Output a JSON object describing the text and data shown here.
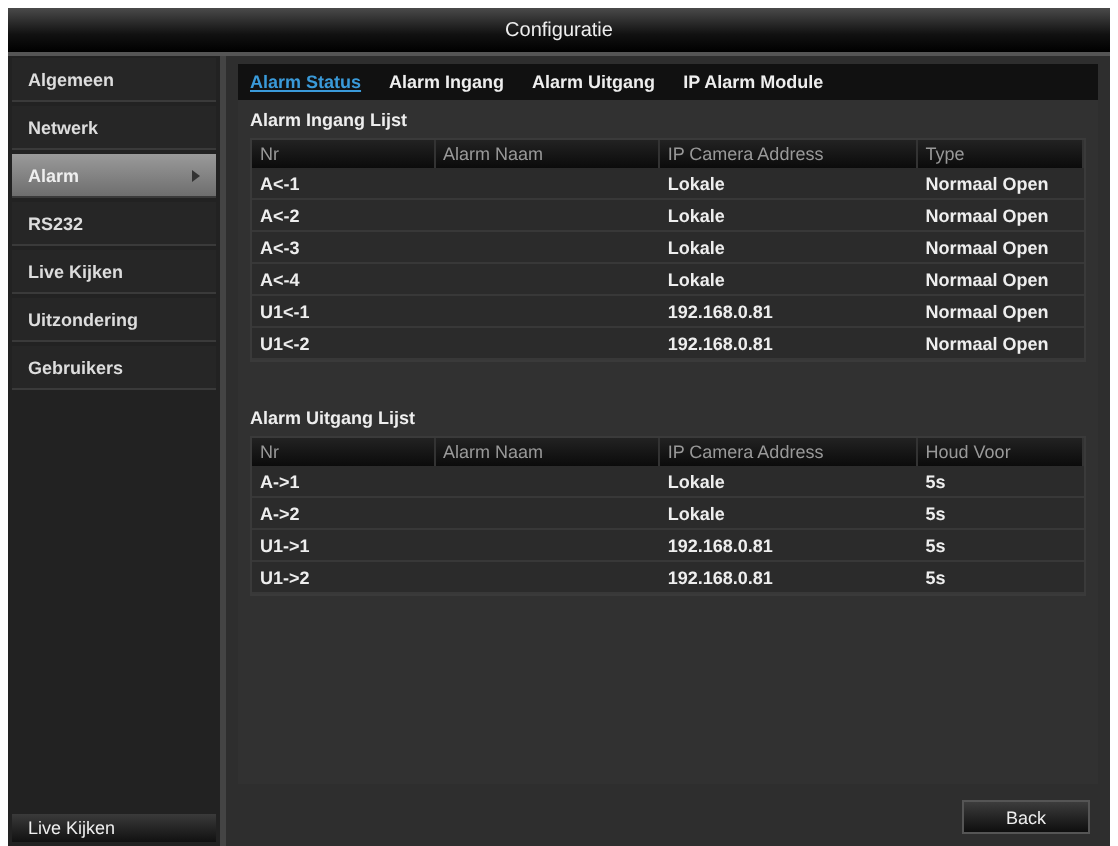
{
  "window": {
    "title": "Configuratie"
  },
  "sidebar": {
    "items": [
      {
        "label": "Algemeen",
        "selected": false
      },
      {
        "label": "Netwerk",
        "selected": false
      },
      {
        "label": "Alarm",
        "selected": true
      },
      {
        "label": "RS232",
        "selected": false
      },
      {
        "label": "Live Kijken",
        "selected": false
      },
      {
        "label": "Uitzondering",
        "selected": false
      },
      {
        "label": "Gebruikers",
        "selected": false
      }
    ],
    "bottom_button": "Live Kijken"
  },
  "tabs": [
    {
      "label": "Alarm Status",
      "selected": true
    },
    {
      "label": "Alarm Ingang",
      "selected": false
    },
    {
      "label": "Alarm Uitgang",
      "selected": false
    },
    {
      "label": "IP Alarm Module",
      "selected": false
    }
  ],
  "tables": [
    {
      "title": "Alarm Ingang Lijst",
      "columns": [
        "Nr",
        "Alarm Naam",
        "IP Camera Address",
        "Type"
      ],
      "rows": [
        [
          "A<-1",
          "",
          "Lokale",
          "Normaal Open"
        ],
        [
          "A<-2",
          "",
          "Lokale",
          "Normaal Open"
        ],
        [
          "A<-3",
          "",
          "Lokale",
          "Normaal Open"
        ],
        [
          "A<-4",
          "",
          "Lokale",
          "Normaal Open"
        ],
        [
          "U1<-1",
          "",
          "192.168.0.81",
          "Normaal Open"
        ],
        [
          "U1<-2",
          "",
          "192.168.0.81",
          "Normaal Open"
        ]
      ]
    },
    {
      "title": "Alarm Uitgang Lijst",
      "columns": [
        "Nr",
        "Alarm Naam",
        "IP Camera Address",
        "Houd Voor"
      ],
      "rows": [
        [
          "A->1",
          "",
          "Lokale",
          "5s"
        ],
        [
          "A->2",
          "",
          "Lokale",
          "5s"
        ],
        [
          "U1->1",
          "",
          "192.168.0.81",
          "5s"
        ],
        [
          "U1->2",
          "",
          "192.168.0.81",
          "5s"
        ]
      ]
    }
  ],
  "back_button": "Back"
}
